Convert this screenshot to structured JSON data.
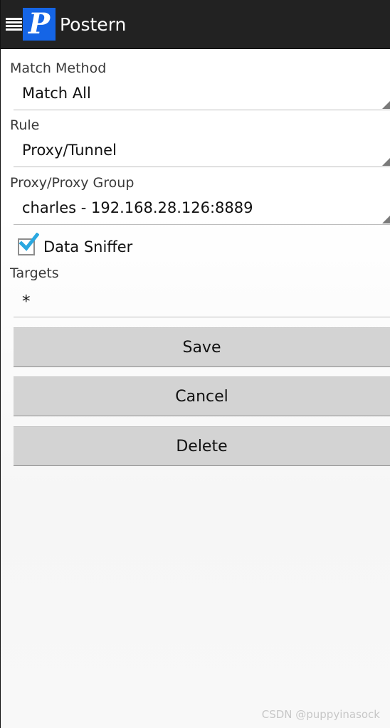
{
  "app": {
    "title": "Postern",
    "logo_letter": "P",
    "logo_color": "#1565e6",
    "drawer_icon": "hamburger-menu-icon"
  },
  "form": {
    "match_method": {
      "label": "Match Method",
      "value": "Match All"
    },
    "rule": {
      "label": "Rule",
      "value": "Proxy/Tunnel"
    },
    "proxy_group": {
      "label": "Proxy/Proxy Group",
      "value": "charles - 192.168.28.126:8889"
    },
    "data_sniffer": {
      "label": "Data Sniffer",
      "checked": true,
      "check_color": "#2aa8e0"
    },
    "targets": {
      "label": "Targets",
      "value": "*"
    }
  },
  "buttons": {
    "save": "Save",
    "cancel": "Cancel",
    "delete": "Delete"
  },
  "watermark": "CSDN @puppyinasock"
}
